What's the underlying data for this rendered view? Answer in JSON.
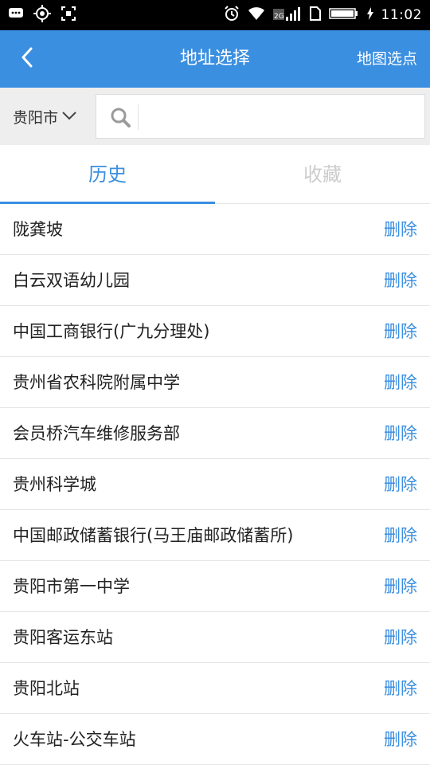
{
  "status_bar": {
    "time": "11:02",
    "network": "2G"
  },
  "header": {
    "title": "地址选择",
    "map_select_label": "地图选点"
  },
  "search": {
    "city": "贵阳市",
    "placeholder": ""
  },
  "tabs": [
    {
      "label": "历史",
      "active": true
    },
    {
      "label": "收藏",
      "active": false
    }
  ],
  "history": [
    {
      "name": "陇龚坡",
      "action": "删除"
    },
    {
      "name": "白云双语幼儿园",
      "action": "删除"
    },
    {
      "name": "中国工商银行(广九分理处)",
      "action": "删除"
    },
    {
      "name": "贵州省农科院附属中学",
      "action": "删除"
    },
    {
      "name": "会员桥汽车维修服务部",
      "action": "删除"
    },
    {
      "name": "贵州科学城",
      "action": "删除"
    },
    {
      "name": "中国邮政储蓄银行(马王庙邮政储蓄所)",
      "action": "删除"
    },
    {
      "name": "贵阳市第一中学",
      "action": "删除"
    },
    {
      "name": "贵阳客运东站",
      "action": "删除"
    },
    {
      "name": "贵阳北站",
      "action": "删除"
    },
    {
      "name": "火车站-公交车站",
      "action": "删除"
    }
  ],
  "colors": {
    "accent": "#3b8fe0",
    "status_bar": "#000000",
    "inactive_tab": "#cccccc"
  }
}
